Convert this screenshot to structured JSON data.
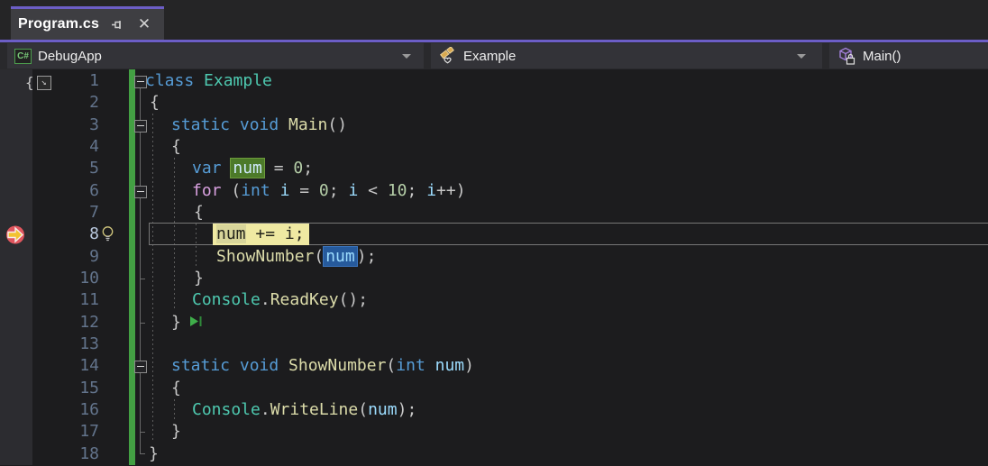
{
  "tab": {
    "title": "Program.cs"
  },
  "navbar": {
    "project": {
      "label": "DebugApp",
      "icon": "csharp-project-icon",
      "icon_text": "C#"
    },
    "type": {
      "label": "Example",
      "icon": "class-internal-icon"
    },
    "member": {
      "label": "Main()",
      "icon": "method-private-icon"
    }
  },
  "colors": {
    "accent_purple": "#6c5ec6",
    "change_bar_green": "#43a043",
    "breakpoint_red": "#e0565e",
    "current_statement_yellow": "#efe9a2",
    "definition_highlight_green": "#4c7a29",
    "reference_highlight_blue": "#265a9c",
    "keyword_blue": "#569CD6",
    "control_keyword_purple": "#D8A0DF",
    "type_teal": "#4EC9B0",
    "method_yellow": "#DCDCAA",
    "identifier_blue": "#9CDCFE",
    "number_green": "#B5CEA8"
  },
  "editor": {
    "lines": [
      {
        "n": "1",
        "indent": 0,
        "fold": true,
        "tokens": [
          {
            "t": "class ",
            "c": "kw"
          },
          {
            "t": "Example",
            "c": "type"
          }
        ]
      },
      {
        "n": "2",
        "indent": 5,
        "tokens": [
          {
            "t": "{",
            "c": "pn"
          }
        ]
      },
      {
        "n": "3",
        "indent": 29,
        "fold": true,
        "tokens": [
          {
            "t": "static void ",
            "c": "kw"
          },
          {
            "t": "Main",
            "c": "fn"
          },
          {
            "t": "()",
            "c": "pn"
          }
        ]
      },
      {
        "n": "4",
        "indent": 29,
        "tokens": [
          {
            "t": "{",
            "c": "pn"
          }
        ]
      },
      {
        "n": "5",
        "indent": 52,
        "tokens": [
          {
            "t": "var ",
            "c": "kw"
          },
          {
            "t": "num",
            "c": "var",
            "box": "def"
          },
          {
            "t": " = ",
            "c": "pn"
          },
          {
            "t": "0",
            "c": "num"
          },
          {
            "t": ";",
            "c": "pn"
          }
        ]
      },
      {
        "n": "6",
        "indent": 52,
        "fold": true,
        "tokens": [
          {
            "t": "for ",
            "c": "ctrl"
          },
          {
            "t": "(",
            "c": "pn"
          },
          {
            "t": "int ",
            "c": "kw"
          },
          {
            "t": "i",
            "c": "var"
          },
          {
            "t": " = ",
            "c": "pn"
          },
          {
            "t": "0",
            "c": "num"
          },
          {
            "t": "; ",
            "c": "pn"
          },
          {
            "t": "i",
            "c": "var"
          },
          {
            "t": " < ",
            "c": "pn"
          },
          {
            "t": "10",
            "c": "num"
          },
          {
            "t": "; ",
            "c": "pn"
          },
          {
            "t": "i",
            "c": "var"
          },
          {
            "t": "++)",
            "c": "pn"
          }
        ]
      },
      {
        "n": "7",
        "indent": 54,
        "tokens": [
          {
            "t": "{",
            "c": "pn"
          }
        ]
      },
      {
        "n": "8",
        "indent": 75,
        "current": true,
        "breakpoint": true,
        "lightbulb": true,
        "stmt": [
          {
            "t": "num",
            "hl": true
          },
          {
            "t": " += i;",
            "hl": false
          }
        ]
      },
      {
        "n": "9",
        "indent": 79,
        "tokens": [
          {
            "t": "ShowNumber",
            "c": "fn"
          },
          {
            "t": "(",
            "c": "pn"
          },
          {
            "t": "num",
            "c": "var",
            "box": "ref"
          },
          {
            "t": ");",
            "c": "pn"
          }
        ]
      },
      {
        "n": "10",
        "indent": 54,
        "tokens": [
          {
            "t": "}",
            "c": "pn"
          }
        ]
      },
      {
        "n": "11",
        "indent": 52,
        "tokens": [
          {
            "t": "Console",
            "c": "type"
          },
          {
            "t": ".",
            "c": "pn"
          },
          {
            "t": "ReadKey",
            "c": "fn"
          },
          {
            "t": "();",
            "c": "pn"
          }
        ]
      },
      {
        "n": "12",
        "indent": 29,
        "glyph": "run-to-cursor",
        "tokens": [
          {
            "t": "}",
            "c": "pn"
          }
        ]
      },
      {
        "n": "13",
        "indent": 0,
        "tokens": []
      },
      {
        "n": "14",
        "indent": 29,
        "fold": true,
        "tokens": [
          {
            "t": "static void ",
            "c": "kw"
          },
          {
            "t": "ShowNumber",
            "c": "fn"
          },
          {
            "t": "(",
            "c": "pn"
          },
          {
            "t": "int ",
            "c": "kw"
          },
          {
            "t": "num",
            "c": "var"
          },
          {
            "t": ")",
            "c": "pn"
          }
        ]
      },
      {
        "n": "15",
        "indent": 29,
        "tokens": [
          {
            "t": "{",
            "c": "pn"
          }
        ]
      },
      {
        "n": "16",
        "indent": 52,
        "tokens": [
          {
            "t": "Console",
            "c": "type"
          },
          {
            "t": ".",
            "c": "pn"
          },
          {
            "t": "WriteLine",
            "c": "fn"
          },
          {
            "t": "(",
            "c": "pn"
          },
          {
            "t": "num",
            "c": "var"
          },
          {
            "t": ");",
            "c": "pn"
          }
        ]
      },
      {
        "n": "17",
        "indent": 29,
        "tokens": [
          {
            "t": "}",
            "c": "pn"
          }
        ]
      },
      {
        "n": "18",
        "indent": 4,
        "tokens": [
          {
            "t": "}",
            "c": "pn"
          }
        ]
      }
    ]
  }
}
